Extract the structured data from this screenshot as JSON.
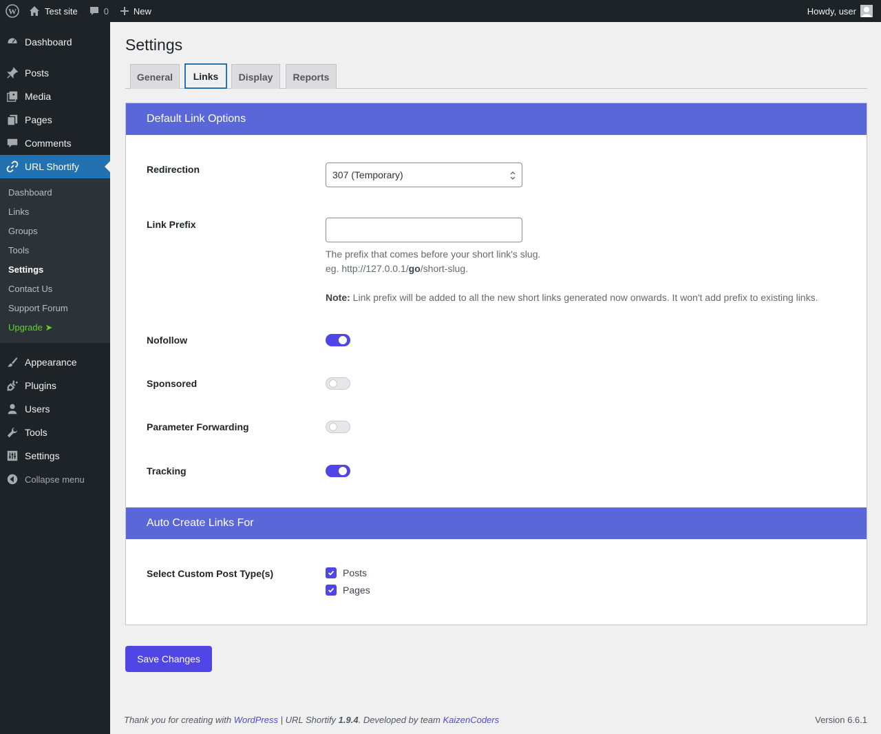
{
  "admin_bar": {
    "site_name": "Test site",
    "comments_count": "0",
    "new_label": "New",
    "greeting": "Howdy, user"
  },
  "sidebar": {
    "items": [
      {
        "label": "Dashboard",
        "icon": "dashboard-icon"
      },
      {
        "label": "Posts",
        "icon": "pin-icon"
      },
      {
        "label": "Media",
        "icon": "media-icon"
      },
      {
        "label": "Pages",
        "icon": "pages-icon"
      },
      {
        "label": "Comments",
        "icon": "comment-icon"
      },
      {
        "label": "URL Shortify",
        "icon": "link-icon"
      },
      {
        "label": "Appearance",
        "icon": "paintbrush-icon"
      },
      {
        "label": "Plugins",
        "icon": "plugin-icon"
      },
      {
        "label": "Users",
        "icon": "user-icon"
      },
      {
        "label": "Tools",
        "icon": "wrench-icon"
      },
      {
        "label": "Settings",
        "icon": "settings-icon"
      }
    ],
    "submenu": [
      "Dashboard",
      "Links",
      "Groups",
      "Tools",
      "Settings",
      "Contact Us",
      "Support Forum",
      "Upgrade ➤"
    ],
    "current_submenu": "Settings",
    "collapse_label": "Collapse menu"
  },
  "page": {
    "title": "Settings",
    "tabs": [
      "General",
      "Links",
      "Display",
      "Reports"
    ],
    "active_tab": "Links"
  },
  "default_link_options": {
    "heading": "Default Link Options",
    "redirection_label": "Redirection",
    "redirection_value": "307 (Temporary)",
    "link_prefix_label": "Link Prefix",
    "link_prefix_value": "",
    "prefix_help_1": "The prefix that comes before your short link's slug.",
    "prefix_help_2_a": "eg. http://127.0.0.1/",
    "prefix_help_2_b": "go",
    "prefix_help_2_c": "/short-slug.",
    "note_label": "Note:",
    "note_text": " Link prefix will be added to all the new short links generated now onwards. It won't add prefix to existing links.",
    "nofollow_label": "Nofollow",
    "nofollow_on": true,
    "sponsored_label": "Sponsored",
    "sponsored_on": false,
    "param_forwarding_label": "Parameter Forwarding",
    "param_forwarding_on": false,
    "tracking_label": "Tracking",
    "tracking_on": true
  },
  "auto_create": {
    "heading": "Auto Create Links For",
    "label": "Select Custom Post Type(s)",
    "options": [
      {
        "label": "Posts",
        "checked": true
      },
      {
        "label": "Pages",
        "checked": true
      }
    ]
  },
  "save_label": "Save Changes",
  "footer": {
    "prefix": "Thank you for creating with ",
    "wp_link": "WordPress",
    "mid": " | URL Shortify ",
    "plugin_version": "1.9.4",
    "dev": ". Developed by team ",
    "dev_link": "KaizenCoders",
    "version": "Version 6.6.1"
  },
  "colors": {
    "accent": "#4f46e5",
    "panel_header": "#5a67d8",
    "admin_active": "#2271b1",
    "sidebar_bg": "#1d2327",
    "upgrade": "#5ed626"
  }
}
